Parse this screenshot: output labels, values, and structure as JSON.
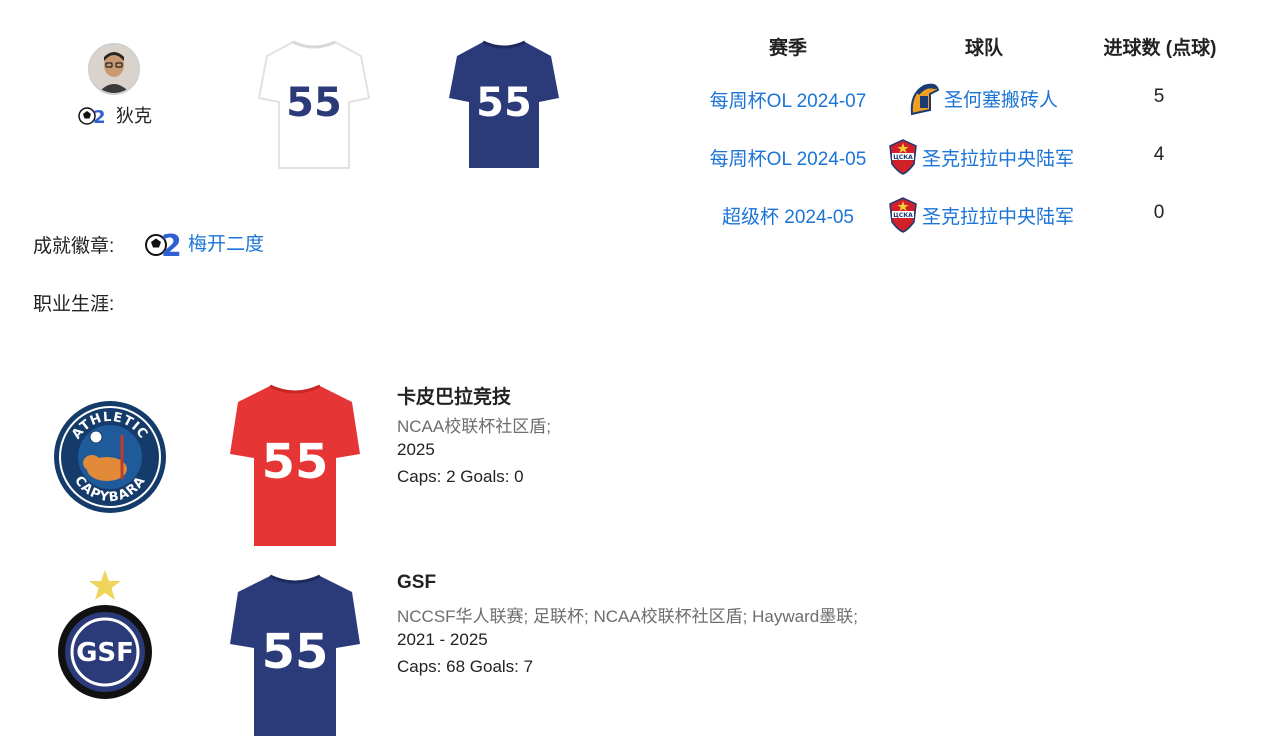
{
  "profile": {
    "player_name": "狄克",
    "kit_number": "55",
    "avatar_icon": "person-avatar-icon",
    "badge_icon": "soccer-ball-2-icon"
  },
  "colors": {
    "home_kit": "#ffffff",
    "away_kit": "#2b3a78",
    "red_kit": "#e53535",
    "link": "#1b74d6",
    "star": "#f0d55c"
  },
  "goals_table": {
    "headers": [
      "赛季",
      "球队",
      "进球数 (点球)"
    ],
    "rows": [
      {
        "season": "每周杯OL 2024-07",
        "team": "圣何塞搬砖人",
        "team_icon": "spartan-helmet-icon",
        "goals": "5"
      },
      {
        "season": "每周杯OL 2024-05",
        "team": "圣克拉拉中央陆军",
        "team_icon": "cska-shield-icon",
        "goals": "4"
      },
      {
        "season": "超级杯 2024-05",
        "team": "圣克拉拉中央陆军",
        "team_icon": "cska-shield-icon",
        "goals": "0"
      }
    ]
  },
  "achievements": {
    "label": "成就徽章:",
    "badge_name": "梅开二度",
    "badge_icon": "soccer-ball-2-icon"
  },
  "career": {
    "label": "职业生涯:",
    "entries": [
      {
        "team": "卡皮巴拉竞技",
        "competitions": "NCAA校联杯社区盾;",
        "years": "2025",
        "stats": "Caps: 2 Goals: 0",
        "logo_icon": "athletic-capybara-logo",
        "logo_text_top": "ATHLETIC",
        "logo_text_bottom": "CAPYBARA",
        "kit_color": "red"
      },
      {
        "team": "GSF",
        "competitions": "NCCSF华人联赛; 足联杯; NCAA校联杯社区盾; Hayward墨联;",
        "years": "2021 - 2025",
        "stats": "Caps: 68 Goals: 7",
        "logo_icon": "gsf-logo",
        "logo_text": "GSF",
        "kit_color": "navy"
      }
    ]
  }
}
